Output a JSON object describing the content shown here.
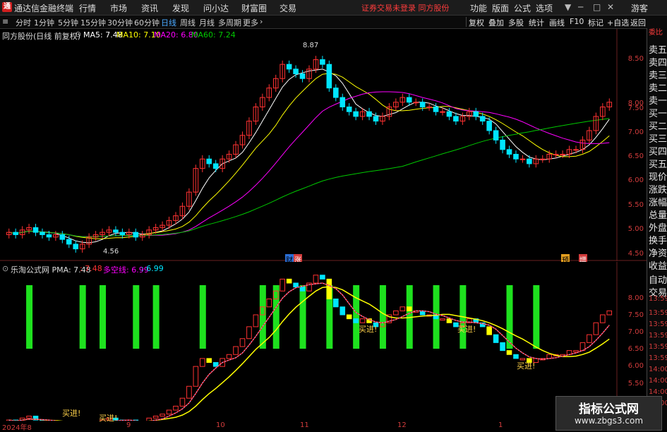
{
  "app": {
    "logo_text": "通",
    "name": "通达信金融终端"
  },
  "menu": {
    "items": [
      "行情",
      "市场",
      "资讯",
      "发现",
      "问小达",
      "财富圈",
      "交易"
    ]
  },
  "notice": {
    "text": "证券交易未登录  同方股份"
  },
  "rmenu": {
    "items": [
      "功能",
      "版面",
      "公式",
      "选项"
    ]
  },
  "user": {
    "label": "游客"
  },
  "periods": [
    "分时",
    "1分钟",
    "5分钟",
    "15分钟",
    "30分钟",
    "60分钟",
    "日线",
    "周线",
    "月线",
    "多周期",
    "更多"
  ],
  "active_period": "日线",
  "tools": [
    "复权",
    "叠加",
    "多股",
    "统计",
    "画线",
    "F10",
    "标记",
    "+自选",
    "返回"
  ],
  "main_panel": {
    "title": "同方股份(日线 前复权)",
    "ma5": "MA5: 7.48",
    "ma10": "MA10: 7.10",
    "ma20": "MA20: 6.80",
    "ma60": "MA60: 7.24",
    "high_label": "8.87",
    "low_label": "4.56",
    "event1": "财",
    "event2": "涨",
    "event3": "预",
    "event4": "增"
  },
  "sub_panel": {
    "title": "乐淘公式网 PMA: 7.48",
    "v1": ": 7.48",
    "v2": "多空线: 6.99",
    "v3": ": 6.99",
    "buy_label": "买进!"
  },
  "side_panel": {
    "top": "委比",
    "items": [
      "卖五",
      "卖四",
      "卖三",
      "卖二",
      "卖一",
      "买一",
      "买二",
      "买三",
      "买四",
      "买五",
      "现价",
      "涨跌",
      "涨幅",
      "总量",
      "外盘",
      "换手",
      "净资",
      "收益"
    ],
    "auto": "自动",
    "trade": "交易"
  },
  "y_axis_main": [
    "8.50",
    "8.00",
    "7.50",
    "7.00",
    "6.50",
    "6.00",
    "5.50",
    "5.00",
    "4.50"
  ],
  "y_axis_sub": [
    "8.00",
    "7.50",
    "7.00",
    "6.50",
    "6.00",
    "5.50"
  ],
  "time_labels": [
    "13:59",
    "13:59",
    "13:59",
    "13:59",
    "13:59",
    "13:59",
    "14:00",
    "14:00",
    "14:00",
    "14:00"
  ],
  "x_axis": [
    "2024年8",
    "9",
    "10",
    "11",
    "12",
    "1"
  ],
  "watermark": {
    "line1": "指标公式网",
    "line2": "www.zbgs3.com"
  },
  "colors": {
    "up": "#ff3232",
    "down": "#00e5ff",
    "ma5": "#ffffff",
    "ma10": "#ffff00",
    "ma20": "#ff00ff",
    "ma60": "#00c800",
    "green_bar": "#1ee11e"
  },
  "chart_data": {
    "type": "candlestick",
    "ylim": [
      4.4,
      8.95
    ],
    "values": [
      4.95,
      4.9,
      5.0,
      5.05,
      4.95,
      4.9,
      4.85,
      4.9,
      4.8,
      4.7,
      4.6,
      4.7,
      4.85,
      4.9,
      4.95,
      5.0,
      4.95,
      4.9,
      4.95,
      4.85,
      4.9,
      5.0,
      5.05,
      5.1,
      5.2,
      5.3,
      5.5,
      5.8,
      6.3,
      6.5,
      6.4,
      6.3,
      6.5,
      6.6,
      6.8,
      7.0,
      7.3,
      7.6,
      7.8,
      8.0,
      8.2,
      8.5,
      8.4,
      8.3,
      8.2,
      8.4,
      8.6,
      8.5,
      8.0,
      7.8,
      7.6,
      7.5,
      7.4,
      7.5,
      7.4,
      7.3,
      7.4,
      7.6,
      7.7,
      7.8,
      7.7,
      7.7,
      7.6,
      7.6,
      7.5,
      7.5,
      7.4,
      7.3,
      7.4,
      7.5,
      7.4,
      7.3,
      7.1,
      6.9,
      6.7,
      6.6,
      6.5,
      6.5,
      6.4,
      6.5,
      6.5,
      6.6,
      6.6,
      6.6,
      6.7,
      6.7,
      6.9,
      7.1,
      7.4,
      7.6,
      7.7
    ]
  }
}
